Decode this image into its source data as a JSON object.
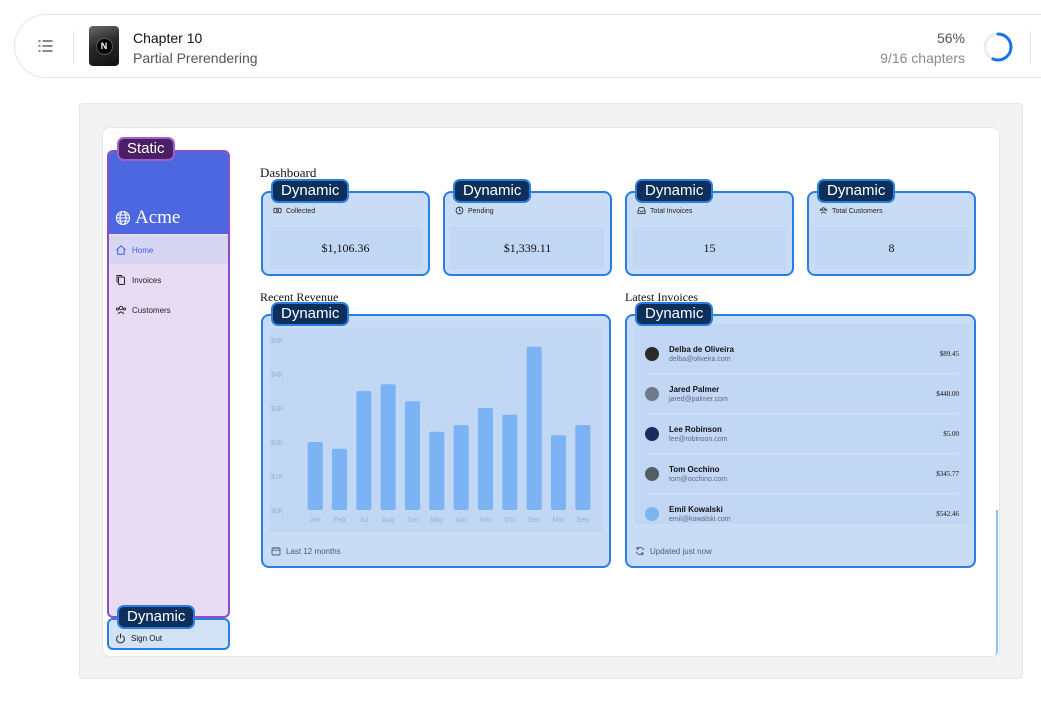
{
  "header": {
    "chapter_title": "Chapter 10",
    "chapter_subtitle": "Partial Prerendering",
    "progress_percent_label": "56%",
    "progress_fraction": 0.56,
    "chapters_label": "9/16 chapters"
  },
  "tags": {
    "static": "Static",
    "dynamic": "Dynamic"
  },
  "sidebar": {
    "brand": "Acme",
    "items": [
      {
        "label": "Home",
        "icon": "home-icon",
        "active": true
      },
      {
        "label": "Invoices",
        "icon": "document-duplicate-icon",
        "active": false
      },
      {
        "label": "Customers",
        "icon": "user-group-icon",
        "active": false
      }
    ],
    "sign_out": "Sign Out"
  },
  "dashboard": {
    "title": "Dashboard",
    "cards": [
      {
        "label": "Collected",
        "value": "$1,106.36",
        "icon": "banknotes-icon"
      },
      {
        "label": "Pending",
        "value": "$1,339.11",
        "icon": "clock-icon"
      },
      {
        "label": "Total Invoices",
        "value": "15",
        "icon": "inbox-icon"
      },
      {
        "label": "Total Customers",
        "value": "8",
        "icon": "user-group-icon"
      }
    ],
    "revenue": {
      "title": "Recent Revenue",
      "footer": "Last 12 months"
    },
    "latest_invoices": {
      "title": "Latest Invoices",
      "footer": "Updated just now",
      "rows": [
        {
          "name": "Delba de Oliveira",
          "email": "delba@oliveira.com",
          "amount": "$89.45",
          "avatar_color": "#2a2a2a"
        },
        {
          "name": "Jared Palmer",
          "email": "jared@palmer.com",
          "amount": "$448.00",
          "avatar_color": "#6b7b8c"
        },
        {
          "name": "Lee Robinson",
          "email": "lee@robinson.com",
          "amount": "$5.00",
          "avatar_color": "#1d2a5c"
        },
        {
          "name": "Tom Occhino",
          "email": "tom@occhino.com",
          "amount": "$345.77",
          "avatar_color": "#555e66"
        },
        {
          "name": "Emil Kowalski",
          "email": "emil@kowalski.com",
          "amount": "$542.46",
          "avatar_color": "#7ab6f0"
        }
      ]
    }
  },
  "chart_data": {
    "type": "bar",
    "categories": [
      "Jan",
      "Feb",
      "Jul",
      "Aug",
      "Jun",
      "May",
      "Apr",
      "Nov",
      "Oct",
      "Dec",
      "Mar",
      "Sep"
    ],
    "values": [
      2000,
      1800,
      3500,
      3700,
      3200,
      2300,
      2500,
      3000,
      2800,
      4800,
      2200,
      2500
    ],
    "ytick_labels": [
      "$0K",
      "$1K",
      "$2K",
      "$3K",
      "$4K",
      "$5K"
    ],
    "ylim": [
      0,
      5000
    ],
    "bar_color": "#7bb3f5",
    "grid": false
  }
}
